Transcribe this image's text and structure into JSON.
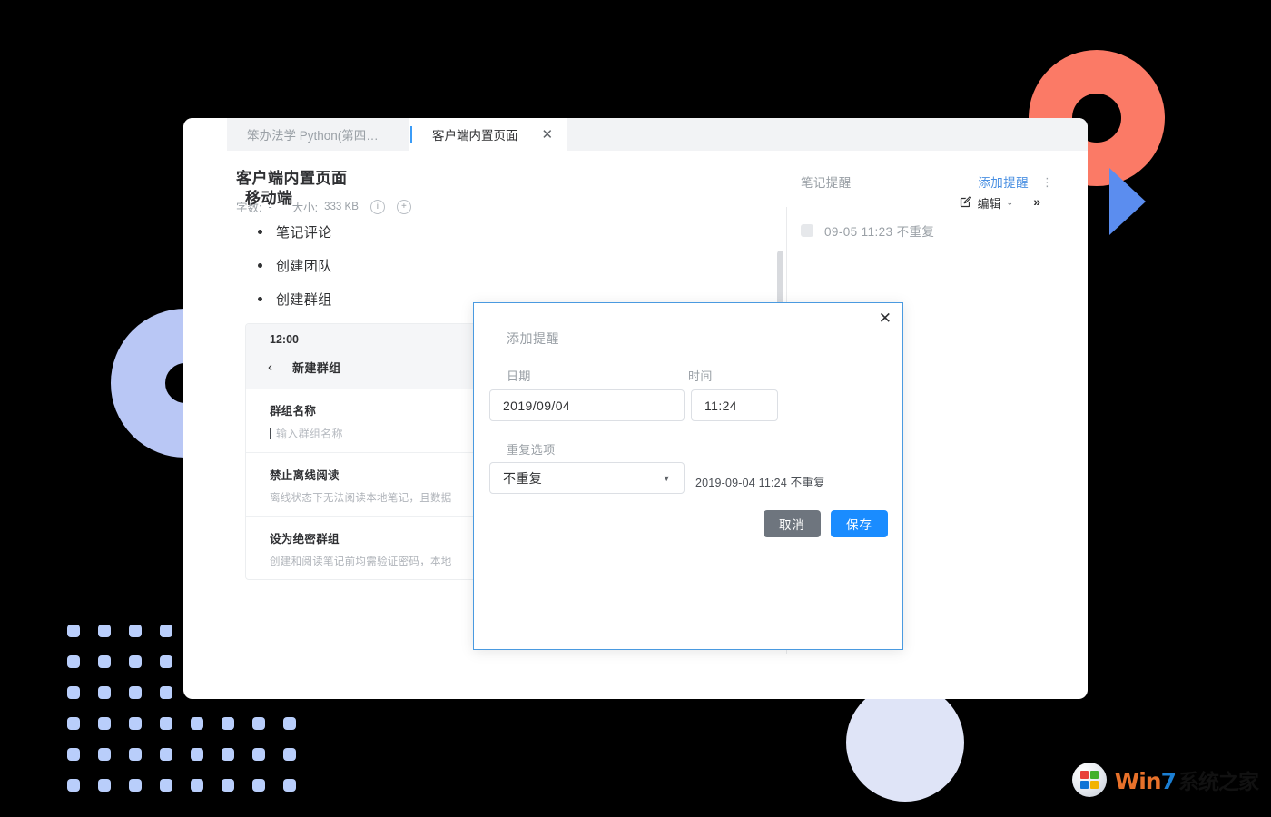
{
  "window": {
    "tabs": [
      {
        "label": "笨办法学 Python(第四版...",
        "active": false,
        "closable": false
      },
      {
        "label": "客户端内置页面",
        "active": true,
        "closable": true,
        "close_glyph": "✕"
      }
    ]
  },
  "document": {
    "title": "客户端内置页面",
    "meta": {
      "word_count_label": "字数:",
      "word_count_value": "-",
      "size_label": "大小:",
      "size_value": "333 KB",
      "info_icon": "info-circle-icon",
      "add_icon": "plus-circle-icon"
    },
    "toolbar": {
      "edit_label": "编辑",
      "edit_icon": "edit-pencil-icon",
      "edit_caret": "⌄",
      "more_label": "»"
    },
    "content": {
      "heading": "移动端",
      "bullets": [
        "笔记评论",
        "创建团队",
        "创建群组"
      ],
      "screenshot": {
        "status_time": "12:00",
        "nav_back_glyph": "‹",
        "nav_title": "新建群组",
        "rows": [
          {
            "label": "群组名称",
            "placeholder": "输入群组名称",
            "type": "input"
          },
          {
            "label": "禁止离线阅读",
            "description": "离线状态下无法阅读本地笔记，且数据",
            "type": "toggle"
          },
          {
            "label": "设为绝密群组",
            "description": "创建和阅读笔记前均需验证密码，本地",
            "type": "toggle"
          }
        ]
      }
    }
  },
  "right_panel": {
    "title": "笔记提醒",
    "add_action": "添加提醒",
    "kebab_glyph": "⋮",
    "reminders": [
      {
        "text": "09-05 11:23 不重复",
        "checked": false
      }
    ]
  },
  "modal": {
    "title": "添加提醒",
    "close_glyph": "✕",
    "fields": {
      "date_label": "日期",
      "date_value": "2019/09/04",
      "time_label": "时间",
      "time_value": "11:24",
      "repeat_label": "重复选项",
      "repeat_value": "不重复",
      "repeat_caret": "▼",
      "repeat_options": [
        "不重复"
      ],
      "preview_text": "2019-09-04 11:24 不重复"
    },
    "buttons": {
      "cancel": "取消",
      "save": "保存"
    },
    "colors": {
      "border": "#4a9ae0",
      "save_bg": "#1a8cff",
      "cancel_bg": "#6e757e"
    }
  },
  "watermark": {
    "win": "Win",
    "seven": "7",
    "cn": "系统之家",
    "logo": "windows-logo-icon"
  },
  "decor": {
    "coral": "#fb7a66",
    "blue_triangle": "#5b8def",
    "periwinkle": "#b9c7f5",
    "lavender": "#dfe4f7",
    "dot": "#b9cefb",
    "background": "#000000"
  }
}
